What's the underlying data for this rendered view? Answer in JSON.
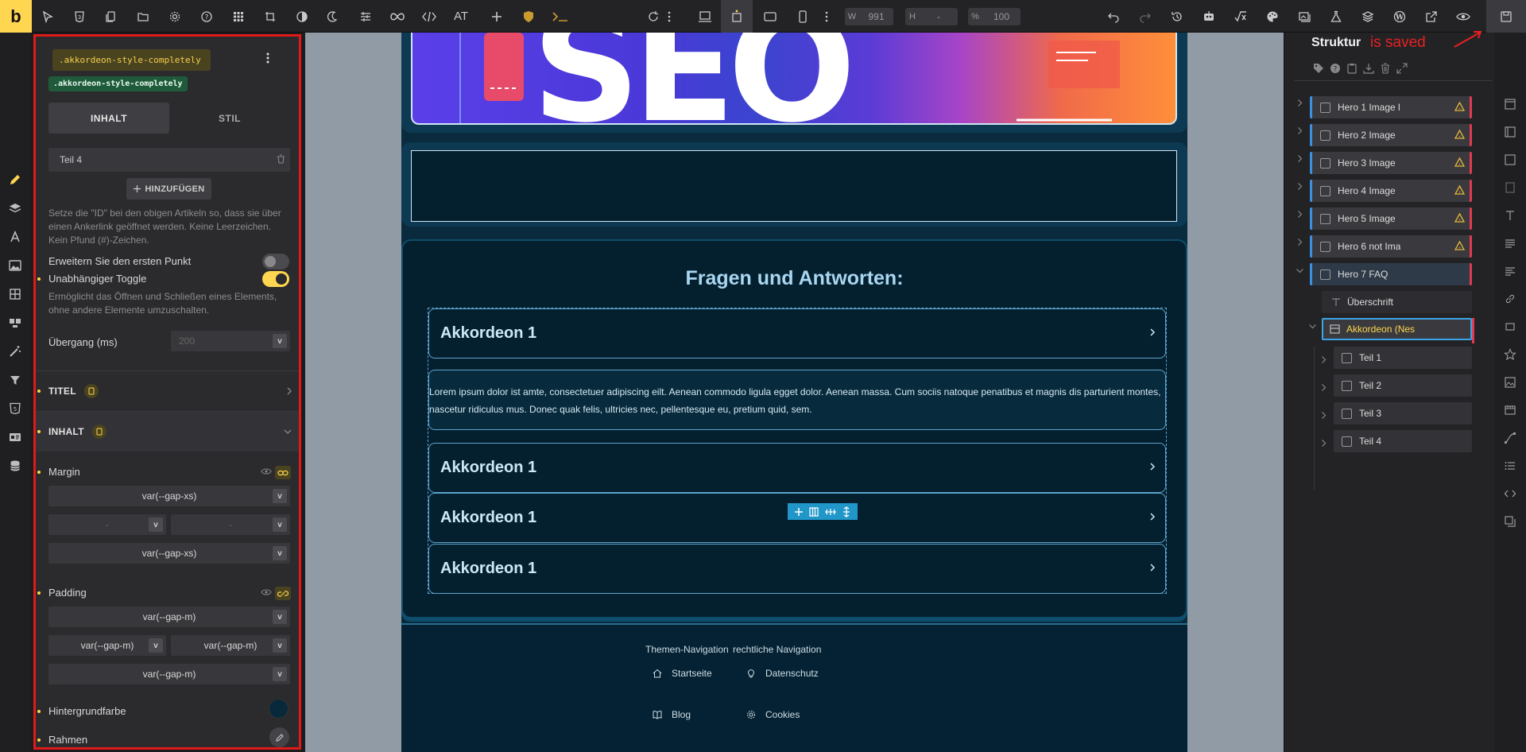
{
  "toolbar": {
    "logo": "b",
    "at_label": "AT",
    "width_label": "W",
    "width_value": "991",
    "height_label": "H",
    "height_value": "-",
    "zoom_label": "%",
    "zoom_value": "100"
  },
  "panel": {
    "class_selector": ".akkordeon-style-completely",
    "class_tag": ".akkordeon-style-completely",
    "tabs": [
      "INHALT",
      "STIL"
    ],
    "item_label": "Teil 4",
    "add_button": "HINZUFÜGEN",
    "id_hint": "Setze die \"ID\" bei den obigen Artikeln so, dass sie über einen Ankerlink geöffnet werden. Keine Leerzeichen. Kein Pfund (#)-Zeichen.",
    "expand_first_label": "Erweitern Sie den ersten Punkt",
    "expand_first_on": false,
    "independent_toggle_label": "Unabhängiger Toggle",
    "independent_toggle_on": true,
    "independent_toggle_hint": "Ermöglicht das Öffnen und Schließen eines Elements, ohne andere Elemente umzuschalten.",
    "transition_label": "Übergang (ms)",
    "transition_placeholder": "200",
    "sections": {
      "titel": "TITEL",
      "inhalt": "INHALT"
    },
    "margin_label": "Margin",
    "margin": {
      "top": "var(--gap-xs)",
      "left": "-",
      "right": "-",
      "bottom": "var(--gap-xs)"
    },
    "padding_label": "Padding",
    "padding": {
      "top": "var(--gap-m)",
      "left": "var(--gap-m)",
      "right": "var(--gap-m)",
      "bottom": "var(--gap-m)"
    },
    "bg_label": "Hintergrundfarbe",
    "bg_color": "#07293a",
    "border_label": "Rahmen",
    "select_arrow": "v"
  },
  "canvas": {
    "faq_title": "Fragen und Antworten:",
    "accordions": [
      "Akkordeon 1",
      "Akkordeon 1",
      "Akkordeon 1",
      "Akkordeon 1"
    ],
    "accordion_body": "Lorem ipsum dolor ist amte, consectetuer adipiscing eilt. Aenean commodo ligula egget dolor. Aenean massa. Cum sociis natoque penatibus et magnis dis parturient montes, nascetur ridiculus mus. Donec quak felis, ultricies nec, pellentesque eu, pretium quid, sem.",
    "footer": {
      "col1_title": "Themen-Navigation",
      "col2_title": "rechtliche Navigation",
      "col1_links": [
        "Startseite",
        "Blog"
      ],
      "col2_links": [
        "Datenschutz",
        "Cookies"
      ]
    }
  },
  "structure": {
    "title": "Struktur",
    "saved_note": "is saved",
    "items": [
      {
        "label": "Hero 1 Image l",
        "warn": true
      },
      {
        "label": "Hero 2 Image",
        "warn": true
      },
      {
        "label": "Hero 3 Image",
        "warn": true
      },
      {
        "label": "Hero 4 Image",
        "warn": true
      },
      {
        "label": "Hero 5 Image",
        "warn": true
      },
      {
        "label": "Hero 6 not Ima",
        "warn": true
      },
      {
        "label": "Hero 7 FAQ",
        "warn": false
      }
    ],
    "heading_item": "Überschrift",
    "accordion_item": "Akkordeon (Nes",
    "children": [
      "Teil 1",
      "Teil 2",
      "Teil 3",
      "Teil 4"
    ]
  },
  "colors": {
    "accent": "#ffd64f",
    "highlight_red": "#e01919",
    "page_bg": "#0a2b3e",
    "selection_blue": "#3da3e6"
  }
}
